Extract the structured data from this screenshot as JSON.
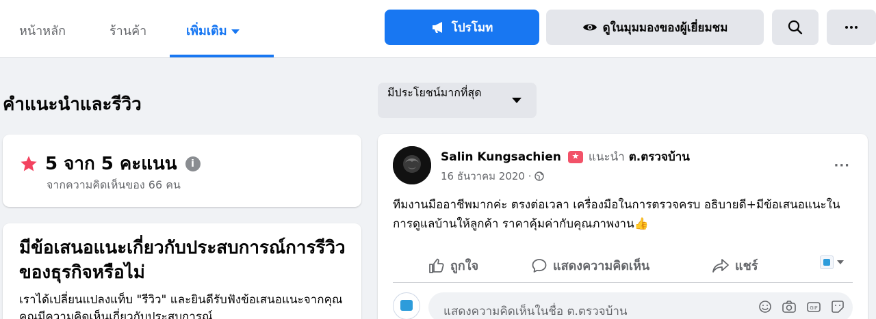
{
  "nav": {
    "tabs": [
      {
        "label": "หน้าหลัก"
      },
      {
        "label": "ร้านค้า"
      },
      {
        "label": "เพิ่มเติม"
      }
    ],
    "promote_label": "โปรโมท",
    "view_as_label": "ดูในมุมมองของผู้เยี่ยมชม"
  },
  "reviews_section": {
    "title": "คำแนะนำและรีวิว",
    "rating_text": "5 จาก 5 คะแนน",
    "rating_basis": "จากความคิดเห็นของ 66 คน"
  },
  "feedback": {
    "title": "มีข้อเสนอแนะเกี่ยวกับประสบการณ์การรีวิวของธุรกิจหรือไม่",
    "body": "เราได้เปลี่ยนแปลงแท็บ \"รีวิว\" และยินดีรับฟังข้อเสนอแนะจากคุณ คุณมีความคิดเห็นเกี่ยวกับประสบการณ์"
  },
  "sort": {
    "label": "มีประโยชน์มากที่สุด"
  },
  "review": {
    "author": "Salin Kungsachien",
    "recommends_label": "แนะนำ",
    "page_name": "ต.ตรวจบ้าน",
    "date": "16 ธันวาคม 2020 ·",
    "text": "ทีมงานมืออาชีพมากค่ะ ตรงต่อเวลา เครื่องมือในการตรวจครบ อธิบายดี+มีข้อเสนอแนะในการดูแลบ้านให้ลูกค้า ราคาคุ้มค่ากับคุณภาพงาน👍",
    "like_label": "ถูกใจ",
    "comment_label": "แสดงความคิดเห็น",
    "share_label": "แชร์",
    "comment_placeholder": "แสดงความคิดเห็นในชื่อ ต.ตรวจบ้าน"
  },
  "colors": {
    "accent": "#1877f2",
    "star": "#f3425f",
    "badge": "#f25268"
  },
  "icons": [
    "megaphone-icon",
    "eye-icon",
    "search-icon",
    "more-icon",
    "star-icon",
    "info-icon",
    "globe-icon",
    "like-icon",
    "comment-icon",
    "share-icon",
    "emoji-icon",
    "camera-icon",
    "gif-icon",
    "sticker-icon"
  ]
}
